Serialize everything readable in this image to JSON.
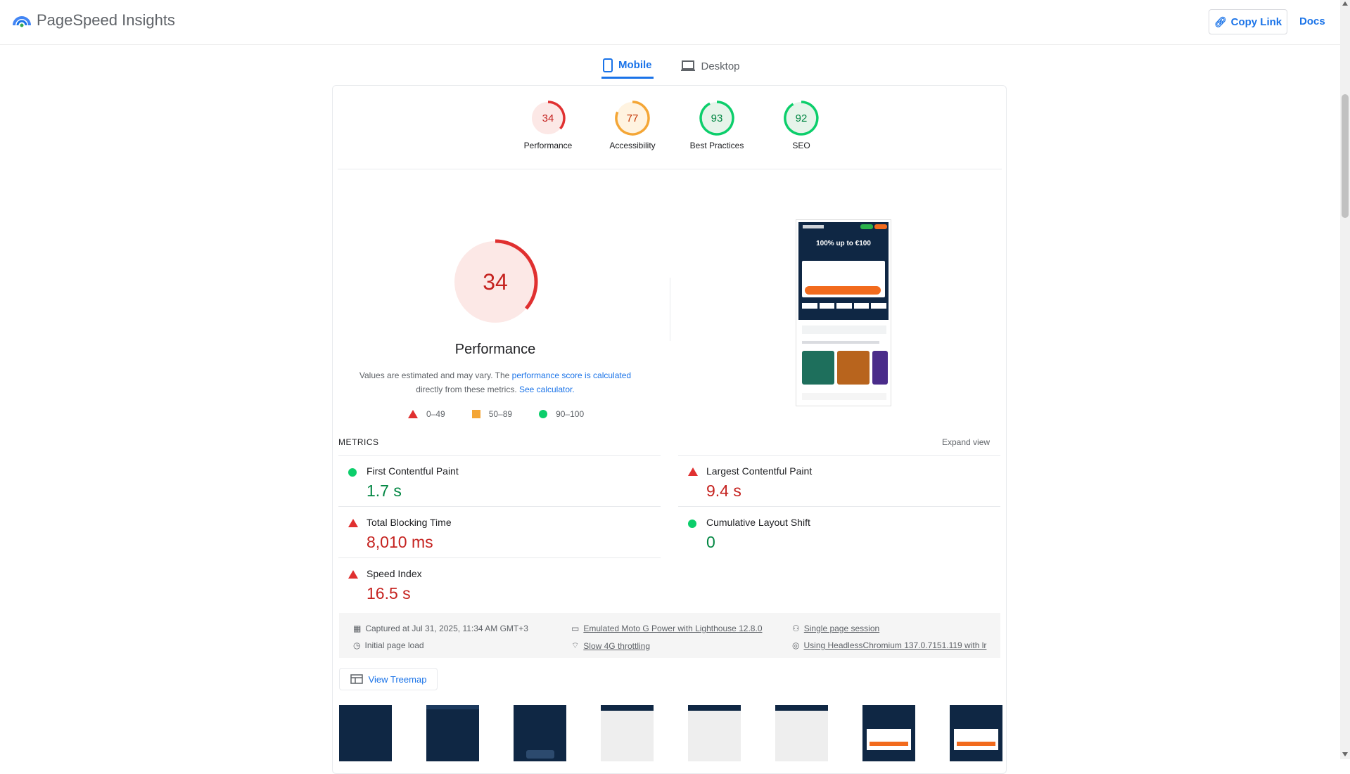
{
  "app": {
    "title": "PageSpeed Insights"
  },
  "header": {
    "copy_link_label": "Copy Link",
    "docs_label": "Docs"
  },
  "tabs": [
    {
      "label": "Mobile",
      "active": true
    },
    {
      "label": "Desktop",
      "active": false
    }
  ],
  "scores": [
    {
      "value": "34",
      "label": "Performance",
      "status": "poor"
    },
    {
      "value": "77",
      "label": "Accessibility",
      "status": "average"
    },
    {
      "value": "93",
      "label": "Best Practices",
      "status": "good"
    },
    {
      "value": "92",
      "label": "SEO",
      "status": "good"
    }
  ],
  "performance": {
    "score": "34",
    "title": "Performance",
    "note_prefix": "Values are estimated and may vary. The ",
    "note_link1": "performance score is calculated",
    "note_mid": "directly from these metrics. ",
    "note_link2": "See calculator."
  },
  "legend": [
    {
      "range": "0–49"
    },
    {
      "range": "50–89"
    },
    {
      "range": "90–100"
    }
  ],
  "screenshot": {
    "headline": "100% up to €100"
  },
  "metrics": {
    "heading": "METRICS",
    "expand_label": "Expand view",
    "items": [
      {
        "label": "First Contentful Paint",
        "value": "1.7 s",
        "status": "good"
      },
      {
        "label": "Largest Contentful Paint",
        "value": "9.4 s",
        "status": "poor"
      },
      {
        "label": "Total Blocking Time",
        "value": "8,010 ms",
        "status": "poor"
      },
      {
        "label": "Cumulative Layout Shift",
        "value": "0",
        "status": "good"
      },
      {
        "label": "Speed Index",
        "value": "16.5 s",
        "status": "poor"
      }
    ]
  },
  "run_info": {
    "captured": "Captured at Jul 31, 2025, 11:34 AM GMT+3",
    "initial_load": "Initial page load",
    "device": "Emulated Moto G Power with Lighthouse 12.8.0",
    "throttling": "Slow 4G throttling",
    "session": "Single page session",
    "browser": "Using HeadlessChromium 137.0.7151.119 with lr"
  },
  "treemap": {
    "label": "View Treemap"
  },
  "colors": {
    "accent": "#1a73e8",
    "poor": "#c5221f",
    "average": "#c33300",
    "good": "#018642"
  }
}
